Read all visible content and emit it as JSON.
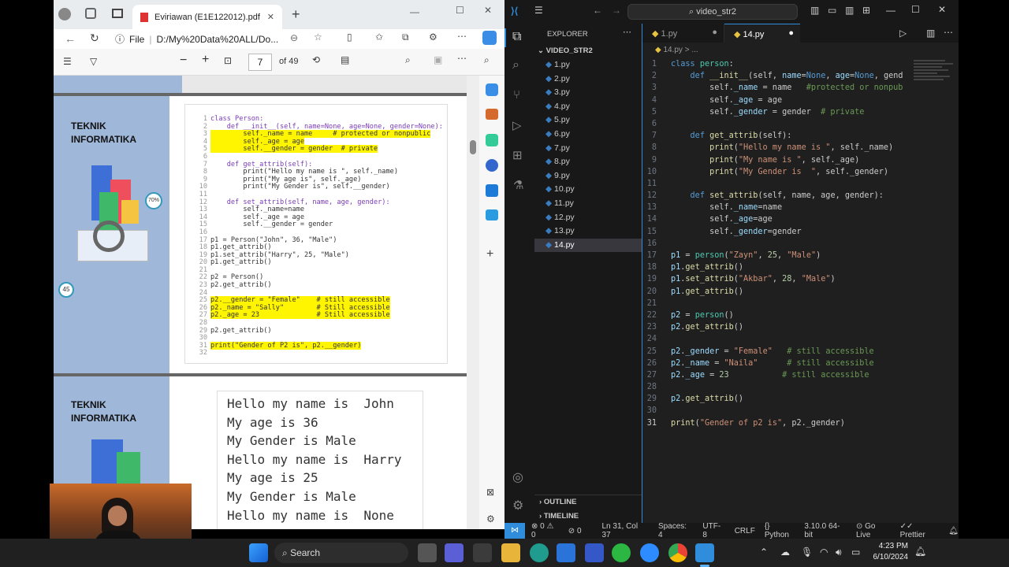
{
  "edge": {
    "tab_title": "Eviriawan (E1E122012).pdf",
    "address_prefix": "File",
    "address": "D:/My%20Data%20ALL/Do...",
    "page_current": "7",
    "page_total": "of 49"
  },
  "slides": {
    "heading_line1": "TEKNIK",
    "heading_line2": "INFORMATIKA",
    "heading2_line1": "TEKNIK",
    "heading2_line2": "INFORMATIKA",
    "code_lines": [
      {
        "n": "1",
        "t": "class Person:",
        "hl": false
      },
      {
        "n": "2",
        "t": "    def __init__(self, name=None, age=None, gender=None):",
        "hl": false
      },
      {
        "n": "3",
        "t": "        self._name = name     # protected or nonpublic",
        "hl": true
      },
      {
        "n": "4",
        "t": "        self._age = age",
        "hl": true
      },
      {
        "n": "5",
        "t": "        self.__gender = gender  # private",
        "hl": true
      },
      {
        "n": "6",
        "t": "",
        "hl": false
      },
      {
        "n": "7",
        "t": "    def get_attrib(self):",
        "hl": false
      },
      {
        "n": "8",
        "t": "        print(\"Hello my name is \", self._name)",
        "hl": false
      },
      {
        "n": "9",
        "t": "        print(\"My age is\", self._age)",
        "hl": false
      },
      {
        "n": "10",
        "t": "        print(\"My Gender is\", self.__gender)",
        "hl": false
      },
      {
        "n": "11",
        "t": "",
        "hl": false
      },
      {
        "n": "12",
        "t": "    def set_attrib(self, name, age, gender):",
        "hl": false
      },
      {
        "n": "13",
        "t": "        self._name=name",
        "hl": false
      },
      {
        "n": "14",
        "t": "        self._age = age",
        "hl": false
      },
      {
        "n": "15",
        "t": "        self.__gender = gender",
        "hl": false
      },
      {
        "n": "16",
        "t": "",
        "hl": false
      },
      {
        "n": "17",
        "t": "p1 = Person(\"John\", 36, \"Male\")",
        "hl": false
      },
      {
        "n": "18",
        "t": "p1.get_attrib()",
        "hl": false
      },
      {
        "n": "19",
        "t": "p1.set_attrib(\"Harry\", 25, \"Male\")",
        "hl": false
      },
      {
        "n": "20",
        "t": "p1.get_attrib()",
        "hl": false
      },
      {
        "n": "21",
        "t": "",
        "hl": false
      },
      {
        "n": "22",
        "t": "p2 = Person()",
        "hl": false
      },
      {
        "n": "23",
        "t": "p2.get_attrib()",
        "hl": false
      },
      {
        "n": "24",
        "t": "",
        "hl": false
      },
      {
        "n": "25",
        "t": "p2.__gender = \"Female\"    # still accessible",
        "hl": true
      },
      {
        "n": "26",
        "t": "p2._name = \"Sally\"        # Still accessible",
        "hl": true
      },
      {
        "n": "27",
        "t": "p2._age = 23              # Still accessible",
        "hl": true
      },
      {
        "n": "28",
        "t": "",
        "hl": false
      },
      {
        "n": "29",
        "t": "p2.get_attrib()",
        "hl": false
      },
      {
        "n": "30",
        "t": "",
        "hl": false
      },
      {
        "n": "31",
        "t": "print(\"Gender of P2 is\", p2.__gender)",
        "hl": true
      },
      {
        "n": "32",
        "t": "",
        "hl": false
      }
    ],
    "output_lines": [
      "Hello my name is  John",
      "My age is 36",
      "My Gender is Male",
      "Hello my name is  Harry",
      "My age is 25",
      "My Gender is Male",
      "Hello my name is  None"
    ],
    "badge_70": "70%",
    "badge_45": "45"
  },
  "vscode": {
    "search": "video_str2",
    "explorer_title": "EXPLORER",
    "folder": "VIDEO_STR2",
    "files": [
      "1.py",
      "2.py",
      "3.py",
      "4.py",
      "5.py",
      "6.py",
      "7.py",
      "8.py",
      "9.py",
      "10.py",
      "11.py",
      "12.py",
      "13.py",
      "14.py"
    ],
    "active_file": "14.py",
    "tab1": "1.py",
    "tab2": "14.py",
    "breadcrumb": "14.py > ...",
    "outline": "OUTLINE",
    "timeline": "TIMELINE",
    "status": {
      "errors": "0",
      "warnings": "0",
      "ports": "0",
      "position": "Ln 31, Col 37",
      "spaces": "Spaces: 4",
      "encoding": "UTF-8",
      "eol": "CRLF",
      "language": "Python",
      "interpreter": "3.10.0 64-bit",
      "golive": "Go Live",
      "prettier": "Prettier"
    }
  },
  "code": [
    [
      [
        "kw",
        "class "
      ],
      [
        "cl",
        "person"
      ],
      [
        "",
        ":"
      ]
    ],
    [
      [
        "",
        "    "
      ],
      [
        "kw",
        "def "
      ],
      [
        "fn",
        "__init__"
      ],
      [
        "",
        "(self, "
      ],
      [
        "vr",
        "name"
      ],
      [
        "",
        "="
      ],
      [
        "kw",
        "None"
      ],
      [
        "",
        ", "
      ],
      [
        "vr",
        "age"
      ],
      [
        "",
        "="
      ],
      [
        "kw",
        "None"
      ],
      [
        "",
        ", gend"
      ]
    ],
    [
      [
        "",
        "        self."
      ],
      [
        "vr",
        "_name"
      ],
      [
        "",
        " = name   "
      ],
      [
        "cm",
        "#protected or nonpub"
      ]
    ],
    [
      [
        "",
        "        self."
      ],
      [
        "vr",
        "_age"
      ],
      [
        "",
        " = age"
      ]
    ],
    [
      [
        "",
        "        self."
      ],
      [
        "vr",
        "_gender"
      ],
      [
        "",
        " = gender  "
      ],
      [
        "cm",
        "# private"
      ]
    ],
    [
      [
        "",
        ""
      ]
    ],
    [
      [
        "",
        "    "
      ],
      [
        "kw",
        "def "
      ],
      [
        "fn",
        "get_attrib"
      ],
      [
        "",
        "(self):"
      ]
    ],
    [
      [
        "",
        "        "
      ],
      [
        "fn",
        "print"
      ],
      [
        "",
        "("
      ],
      [
        "st",
        "\"Hello my name is \""
      ],
      [
        "",
        ", self._name)"
      ]
    ],
    [
      [
        "",
        "        "
      ],
      [
        "fn",
        "print"
      ],
      [
        "",
        "("
      ],
      [
        "st",
        "\"My name is \""
      ],
      [
        "",
        ", self._age)"
      ]
    ],
    [
      [
        "",
        "        "
      ],
      [
        "fn",
        "print"
      ],
      [
        "",
        "("
      ],
      [
        "st",
        "\"My Gender is  \""
      ],
      [
        "",
        ", self._gender)"
      ]
    ],
    [
      [
        "",
        ""
      ]
    ],
    [
      [
        "",
        "    "
      ],
      [
        "kw",
        "def "
      ],
      [
        "fn",
        "set_attrib"
      ],
      [
        "",
        "(self, name, age, gender):"
      ]
    ],
    [
      [
        "",
        "        self."
      ],
      [
        "vr",
        "_name"
      ],
      [
        "",
        "=name"
      ]
    ],
    [
      [
        "",
        "        self."
      ],
      [
        "vr",
        "_age"
      ],
      [
        "",
        "=age"
      ]
    ],
    [
      [
        "",
        "        self."
      ],
      [
        "vr",
        "_gender"
      ],
      [
        "",
        "=gender"
      ]
    ],
    [
      [
        "",
        ""
      ]
    ],
    [
      [
        "vr",
        "p1"
      ],
      [
        "",
        " = "
      ],
      [
        "cl",
        "person"
      ],
      [
        "",
        "("
      ],
      [
        "st",
        "\"Zayn\""
      ],
      [
        "",
        ", "
      ],
      [
        "nm",
        "25"
      ],
      [
        "",
        ", "
      ],
      [
        "st",
        "\"Male\""
      ],
      [
        "",
        ")"
      ]
    ],
    [
      [
        "vr",
        "p1"
      ],
      [
        "",
        "."
      ],
      [
        "fn",
        "get_attrib"
      ],
      [
        "",
        "()"
      ]
    ],
    [
      [
        "vr",
        "p1"
      ],
      [
        "",
        "."
      ],
      [
        "fn",
        "set_attrib"
      ],
      [
        "",
        "("
      ],
      [
        "st",
        "\"Akbar\""
      ],
      [
        "",
        ", "
      ],
      [
        "nm",
        "28"
      ],
      [
        "",
        ", "
      ],
      [
        "st",
        "\"Male\""
      ],
      [
        "",
        ")"
      ]
    ],
    [
      [
        "vr",
        "p1"
      ],
      [
        "",
        "."
      ],
      [
        "fn",
        "get_attrib"
      ],
      [
        "",
        "()"
      ]
    ],
    [
      [
        "",
        ""
      ]
    ],
    [
      [
        "vr",
        "p2"
      ],
      [
        "",
        " = "
      ],
      [
        "cl",
        "person"
      ],
      [
        "",
        "()"
      ]
    ],
    [
      [
        "vr",
        "p2"
      ],
      [
        "",
        "."
      ],
      [
        "fn",
        "get_attrib"
      ],
      [
        "",
        "()"
      ]
    ],
    [
      [
        "",
        ""
      ]
    ],
    [
      [
        "vr",
        "p2"
      ],
      [
        "",
        "."
      ],
      [
        "vr",
        "_gender"
      ],
      [
        "",
        " = "
      ],
      [
        "st",
        "\"Female\""
      ],
      [
        "",
        "   "
      ],
      [
        "cm",
        "# still accessible"
      ]
    ],
    [
      [
        "vr",
        "p2"
      ],
      [
        "",
        "."
      ],
      [
        "vr",
        "_name"
      ],
      [
        "",
        " = "
      ],
      [
        "st",
        "\"Naila\""
      ],
      [
        "",
        "      "
      ],
      [
        "cm",
        "# still accessible"
      ]
    ],
    [
      [
        "vr",
        "p2"
      ],
      [
        "",
        "."
      ],
      [
        "vr",
        "_age"
      ],
      [
        "",
        " = "
      ],
      [
        "nm",
        "23"
      ],
      [
        "",
        "           "
      ],
      [
        "cm",
        "# still accessible"
      ]
    ],
    [
      [
        "",
        ""
      ]
    ],
    [
      [
        "vr",
        "p2"
      ],
      [
        "",
        "."
      ],
      [
        "fn",
        "get_attrib"
      ],
      [
        "",
        "()"
      ]
    ],
    [
      [
        "",
        ""
      ]
    ],
    [
      [
        "fn",
        "print"
      ],
      [
        "",
        "("
      ],
      [
        "st",
        "\"Gender of p2 is\""
      ],
      [
        "",
        ", p2._gender)"
      ]
    ]
  ],
  "taskbar": {
    "search": "Search",
    "time": "4:23 PM",
    "date": "6/10/2024"
  }
}
